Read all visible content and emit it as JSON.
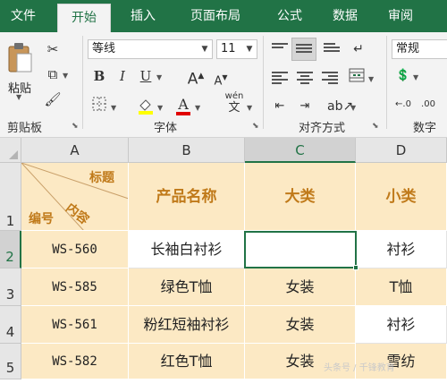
{
  "tabs": [
    {
      "label": "文件",
      "active": false
    },
    {
      "label": "开始",
      "active": true
    },
    {
      "label": "插入",
      "active": false
    },
    {
      "label": "页面布局",
      "active": false
    },
    {
      "label": "公式",
      "active": false
    },
    {
      "label": "数据",
      "active": false
    },
    {
      "label": "审阅",
      "active": false
    }
  ],
  "ribbon": {
    "clipboard": {
      "paste_label": "粘贴",
      "group_label": "剪贴板"
    },
    "font": {
      "name": "等线",
      "size": "11",
      "bold": "B",
      "italic": "I",
      "underline": "U",
      "grow": "A",
      "shrink": "A",
      "font_color": "A",
      "wen": "wén",
      "wen_char": "文",
      "group_label": "字体"
    },
    "alignment": {
      "group_label": "对齐方式"
    },
    "number": {
      "format": "常规",
      "group_label": "数字"
    }
  },
  "columns": [
    {
      "label": "A",
      "selected": false
    },
    {
      "label": "B",
      "selected": false
    },
    {
      "label": "C",
      "selected": true
    },
    {
      "label": "D",
      "selected": false
    }
  ],
  "rows": [
    {
      "label": "1",
      "selected": false
    },
    {
      "label": "2",
      "selected": true
    },
    {
      "label": "3",
      "selected": false
    },
    {
      "label": "4",
      "selected": false
    },
    {
      "label": "5",
      "selected": false
    }
  ],
  "header_row": {
    "diag_top": "标题",
    "diag_mid": "内容",
    "diag_bottom": "编号",
    "product_name": "产品名称",
    "category": "大类",
    "subcategory": "小类"
  },
  "data_rows": [
    {
      "code": "WS-560",
      "name": "长袖白衬衫",
      "category": "",
      "sub": "衬衫"
    },
    {
      "code": "WS-585",
      "name": "绿色T恤",
      "category": "女装",
      "sub": "T恤"
    },
    {
      "code": "WS-561",
      "name": "粉红短袖衬衫",
      "category": "女装",
      "sub": "衬衫"
    },
    {
      "code": "WS-582",
      "name": "红色T恤",
      "category": "女装",
      "sub": "雪纺"
    }
  ],
  "watermark": "头条号 / 千锋教育",
  "colors": {
    "accent": "#217346",
    "header_fill": "#fce9c4",
    "header_text": "#c07a1a"
  }
}
